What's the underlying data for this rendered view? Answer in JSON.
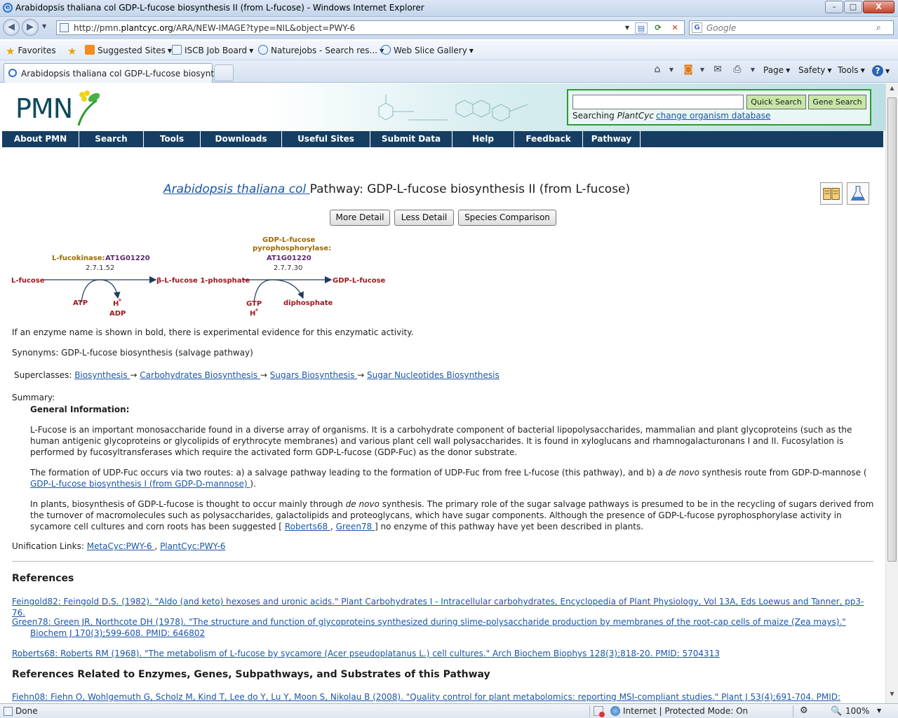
{
  "window": {
    "title": "Arabidopsis thaliana col GDP-L-fucose biosynthesis II (from L-fucose) - Windows Internet Explorer",
    "controls": {
      "minimize": "–",
      "maximize": "□",
      "close": "X"
    }
  },
  "address": {
    "url_prefix": "http://pmn.",
    "url_domain": "plantcyc.org",
    "url_path": "/ARA/NEW-IMAGE?type=NIL&object=PWY-6",
    "search_placeholder": "Google",
    "search_engine_icon": "G"
  },
  "favorites_bar": {
    "favorites_label": "Favorites",
    "items": [
      {
        "label": "Suggested Sites"
      },
      {
        "label": "ISCB Job Board"
      },
      {
        "label": "Naturejobs - Search res..."
      },
      {
        "label": "Web Slice Gallery"
      }
    ]
  },
  "tabs": [
    {
      "label": "Arabidopsis thaliana col GDP-L-fucose biosynthe..."
    }
  ],
  "command_bar": {
    "page": "Page",
    "safety": "Safety",
    "tools": "Tools",
    "help": "?"
  },
  "pmn": {
    "logo": "PMN",
    "search_panel": {
      "quick_search": "Quick Search",
      "gene_search": "Gene Search",
      "searching_prefix": "Searching ",
      "searching_db": "PlantCyc",
      "change_db": "change organism database"
    },
    "menu": [
      "About PMN",
      "Search",
      "Tools",
      "Downloads",
      "Useful Sites",
      "Submit Data",
      "Help",
      "Feedback",
      "Pathway"
    ]
  },
  "page": {
    "organism_link": "Arabidopsis thaliana col ",
    "title": "Pathway: GDP-L-fucose biosynthesis II (from L-fucose)",
    "buttons": {
      "more": "More Detail",
      "less": "Less Detail",
      "species": "Species Comparison"
    },
    "diagram": {
      "enzyme1_name": "L-fucokinase: ",
      "enzyme1_gene": "AT1G01220",
      "enzyme1_ec": "2.7.1.52",
      "enzyme2_name_l1": "GDP-L-fucose",
      "enzyme2_name_l2": "pyrophosphorylase:",
      "enzyme2_gene": "AT1G01220",
      "enzyme2_ec": "2.7.7.30",
      "c1": "L-fucose",
      "c2": "β-L-fucose 1-phosphate",
      "c3": "GDP-L-fucose",
      "s1_in": "ATP",
      "s1_out_h": "H",
      "s1_out": "ADP",
      "s2_in": "GTP",
      "s2_in_h": "H",
      "s2_out": "diphosphate",
      "plus": "+"
    },
    "enzyme_note": "If an enzyme name is shown in bold, there is experimental evidence for this enzymatic activity.",
    "synonyms": "Synonyms: GDP-L-fucose biosynthesis (salvage pathway)",
    "superclasses_label": "Superclasses: ",
    "superclasses": [
      "Biosynthesis ",
      "Carbohydrates Biosynthesis ",
      "Sugars Biosynthesis ",
      "Sugar Nucleotides Biosynthesis"
    ],
    "arrow": " → ",
    "summary_label": "Summary:",
    "general_info": "General Information:",
    "para1": "L-Fucose is an important monosaccharide found in a diverse array of organisms. It is a carbohydrate component of bacterial lipopolysaccharides, mammalian and plant glycoproteins (such as the human antigenic glycoproteins or glycolipids of erythrocyte membranes) and various plant cell wall polysaccharides. It is found in xyloglucans and rhamnogalacturonans I and II. Fucosylation is performed by fucosyltransferases which require the activated form GDP-L-fucose (GDP-Fuc) as the donor substrate.",
    "para2_a": "The formation of UDP-Fuc occurs via two routes: a) a salvage pathway leading to the formation of UDP-Fuc from free L-fucose (this pathway), and b) a ",
    "para2_em": "de novo",
    "para2_b": " synthesis route from GDP-D-mannose ( ",
    "para2_link": "GDP-L-fucose biosynthesis I (from GDP-D-mannose) ",
    "para2_c": ").",
    "para3_a": "In plants, biosynthesis of GDP-L-fucose is thought to occur mainly through ",
    "para3_em": "de novo",
    "para3_b": " synthesis. The primary role of the sugar salvage pathways is presumed to be in the recycling of sugars derived from the turnover of macromolecules such as polysaccharides, galactolipids and proteoglycans, which have sugar components. Although the presence of GDP-L-fucose pyrophosphorylase activity in sycamore cell cultures and corn roots has been suggested [ ",
    "para3_link1": "Roberts68 ",
    "para3_sep": ", ",
    "para3_link2": "Green78 ",
    "para3_c": "] no enzyme of this pathway have yet been described in plants.",
    "unification_label": "Unification Links: ",
    "unification": [
      "MetaCyc:PWY-6 ",
      "PlantCyc:PWY-6"
    ],
    "unification_sep": ", ",
    "references_heading": "References",
    "references": [
      {
        "key": "Feingold82:",
        "text": " Feingold D.S. (1982). \"Aldo (and keto) hexoses and uronic acids.\" Plant Carbohydrates I - Intracellular carbohydrates, Encyclopedia of Plant Physiology, Vol 13A, Eds Loewus and Tanner, pp3-76."
      },
      {
        "key": "Green78:",
        "text": " Green JR, Northcote DH (1978). \"The structure and function of glycoproteins synthesized during slime-polysaccharide production by membranes of the root-cap cells of maize (Zea mays).\" Biochem J 170(3);599-608. PMID: 646802"
      },
      {
        "key": "Roberts68:",
        "text": " Roberts RM (1968). \"The metabolism of L-fucose by sycamore (Acer pseudoplatanus L.) cell cultures.\" Arch Biochem Biophys 128(3);818-20. PMID: 5704313"
      }
    ],
    "related_heading": "References Related to Enzymes, Genes, Subpathways, and Substrates of this Pathway",
    "related": [
      {
        "key": "Fiehn08:",
        "text": " Fiehn O, Wohlgemuth G, Scholz M, Kind T, Lee do Y, Lu Y, Moon S, Nikolau B (2008). \"Quality control for plant metabolomics: reporting MSI-compliant studies.\" Plant J 53(4);691-704. PMID:"
      }
    ]
  },
  "status": {
    "text": "Done",
    "zone": "Internet | Protected Mode: On",
    "zoom": "100%"
  },
  "colors": {
    "menu_bg": "#163e63",
    "compound": "#a0161b",
    "enzyme_name": "#9a6a00",
    "gene": "#5b2a6e",
    "link": "#1a55a8",
    "search_border": "#2c9c2c"
  }
}
